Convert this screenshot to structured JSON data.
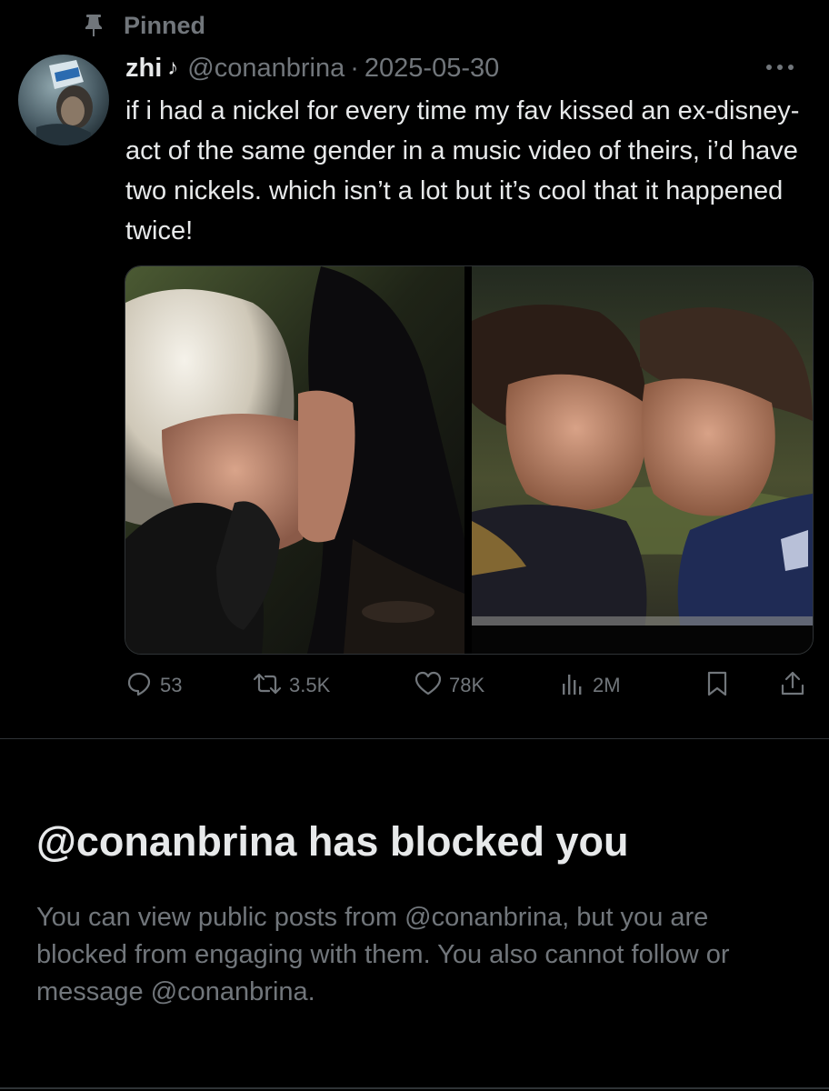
{
  "pinned": {
    "label": "Pinned",
    "icon": "pin-icon"
  },
  "post": {
    "avatar_icon": "avatar-image",
    "display_name": "zhi",
    "name_note": "♪",
    "handle": "@conanbrina",
    "separator": "·",
    "date": "2025-05-30",
    "more_icon": "more-options-icon",
    "text": "if i had a nickel for every time my fav kissed an ex-disney-act of the same gender in a music video of theirs, i’d have two nickels. which isn’t a lot but it’s cool that it happened twice!",
    "media": [
      {
        "kind": "photo",
        "icon": "photo-image"
      },
      {
        "kind": "photo",
        "icon": "photo-image"
      }
    ],
    "actions": {
      "replies": "53",
      "reposts": "3.5K",
      "likes": "78K",
      "views": "2M"
    }
  },
  "blocked": {
    "title": "@conanbrina has blocked you",
    "body": "You can view public posts from @conanbrina, but you are blocked from engaging with them. You also cannot follow or message @conanbrina."
  },
  "colors": {
    "background": "#000000",
    "primary_text": "#e7e9ea",
    "secondary_text": "#71767b",
    "divider": "#2f3336"
  }
}
